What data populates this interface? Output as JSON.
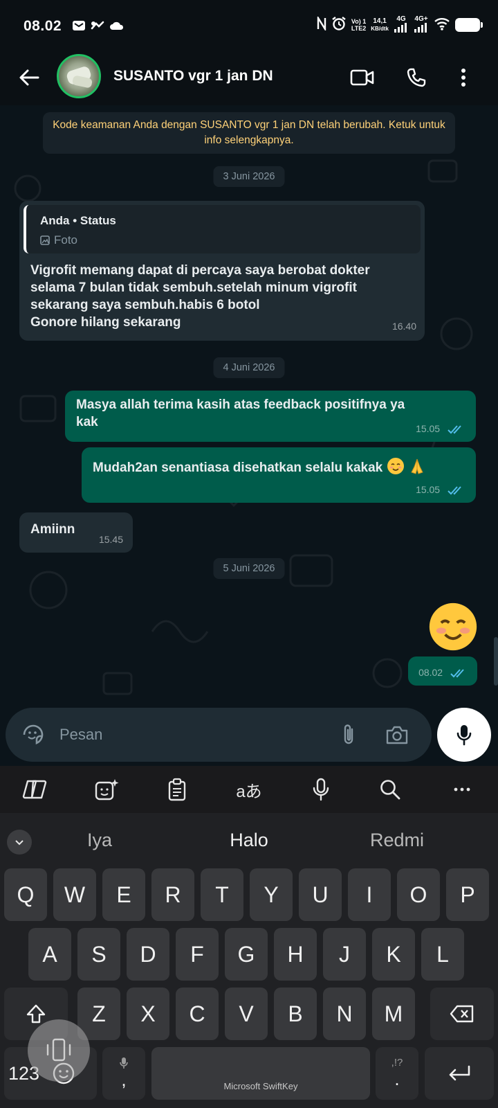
{
  "status_bar": {
    "time": "08.02",
    "volte": "Vo) 1",
    "lte": "LTE2",
    "speed_value": "14,1",
    "speed_unit": "KB/dtk",
    "net1": "4G",
    "net2": "4G+"
  },
  "header": {
    "contact_name": "SUSANTO vgr 1 jan DN"
  },
  "chat": {
    "security_notice": "Kode keamanan Anda dengan SUSANTO vgr 1 jan DN telah berubah. Ketuk untuk info selengkapnya.",
    "dates": [
      "3 Juni 2026",
      "4 Juni 2026",
      "5 Juni 2026"
    ],
    "messages": [
      {
        "direction": "in",
        "quote_title": "Anda • Status",
        "quote_sub": "Foto",
        "lines": [
          "Vigrofit memang dapat di percaya saya berobat dokter",
          "selama 7 bulan tidak sembuh.setelah minum vigrofit",
          "sekarang saya sembuh.habis 6 botol",
          "Gonore hilang sekarang"
        ],
        "time": "16.40"
      },
      {
        "direction": "out",
        "lines": [
          "Masya allah terima kasih atas feedback positifnya ya",
          "kak"
        ],
        "time": "15.05"
      },
      {
        "direction": "out",
        "text": "Mudah2an senantiasa disehatkan selalu kakak",
        "time": "15.05"
      },
      {
        "direction": "in",
        "text": "Amiinn",
        "time": "15.45"
      },
      {
        "direction": "out",
        "emoji": "smiling-face-with-smiling-eyes",
        "time": "08.02"
      }
    ]
  },
  "input": {
    "placeholder": "Pesan"
  },
  "keyboard": {
    "suggestions": [
      "Iya",
      "Halo",
      "Redmi"
    ],
    "row1": [
      "Q",
      "W",
      "E",
      "R",
      "T",
      "Y",
      "U",
      "I",
      "O",
      "P"
    ],
    "row2": [
      "A",
      "S",
      "D",
      "F",
      "G",
      "H",
      "J",
      "K",
      "L"
    ],
    "row3": [
      "Z",
      "X",
      "C",
      "V",
      "B",
      "N",
      "M"
    ],
    "numbers_key": "123",
    "comma_key": ",",
    "period_key": ".",
    "punct_hint": ",!?",
    "space_label": "Microsoft SwiftKey",
    "translate_label": "aあ"
  },
  "colors": {
    "incoming_bubble": "#202c33",
    "outgoing_bubble": "#005c4b",
    "read_ticks": "#53bdeb",
    "avatar_ring": "#21c063",
    "security_text": "#ffd279"
  }
}
